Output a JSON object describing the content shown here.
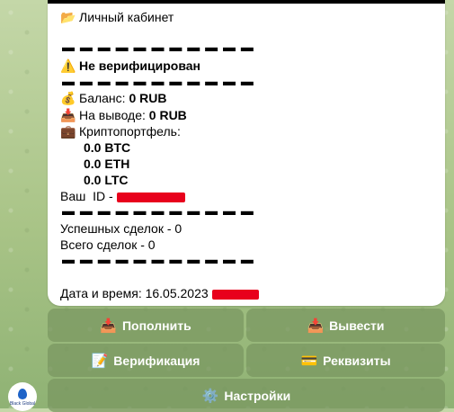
{
  "message": {
    "header": {
      "icon": "folder-icon",
      "text": "Личный кабинет"
    },
    "separator": "▬ ▬ ▬ ▬ ▬ ▬ ▬ ▬ ▬ ▬ ▬",
    "verification_status": {
      "icon": "warning-icon",
      "text": "Не верифицирован"
    },
    "balance": {
      "icon": "money-bag-icon",
      "label": "Баланс:",
      "value": "0 RUB"
    },
    "withdrawal": {
      "icon": "inbox-tray-icon",
      "label": "На выводе:",
      "value": "0 RUB"
    },
    "portfolio": {
      "icon": "briefcase-icon",
      "label": "Криптопортфель:"
    },
    "crypto": [
      "0.0 BTC",
      "0.0 ETH",
      "0.0 LTC"
    ],
    "user_id_label": "Ваш  ID -",
    "successful_deals": "Успешных сделок - 0",
    "total_deals": "Всего сделок - 0",
    "datetime": "Дата и время: 16.05.2023"
  },
  "keyboard": {
    "deposit": {
      "icon": "inbox-tray-icon",
      "label": "Пополнить"
    },
    "withdraw": {
      "icon": "inbox-tray-icon",
      "label": "Вывести"
    },
    "verification": {
      "icon": "memo-icon",
      "label": "Верификация"
    },
    "requisites": {
      "icon": "credit-card-icon",
      "label": "Реквизиты"
    },
    "settings": {
      "icon": "gear-icon",
      "label": "Настройки"
    }
  },
  "avatar": {
    "text": "Black Global"
  },
  "colors": {
    "redaction": "#e8001c",
    "button_bg": "#7d9a60"
  }
}
